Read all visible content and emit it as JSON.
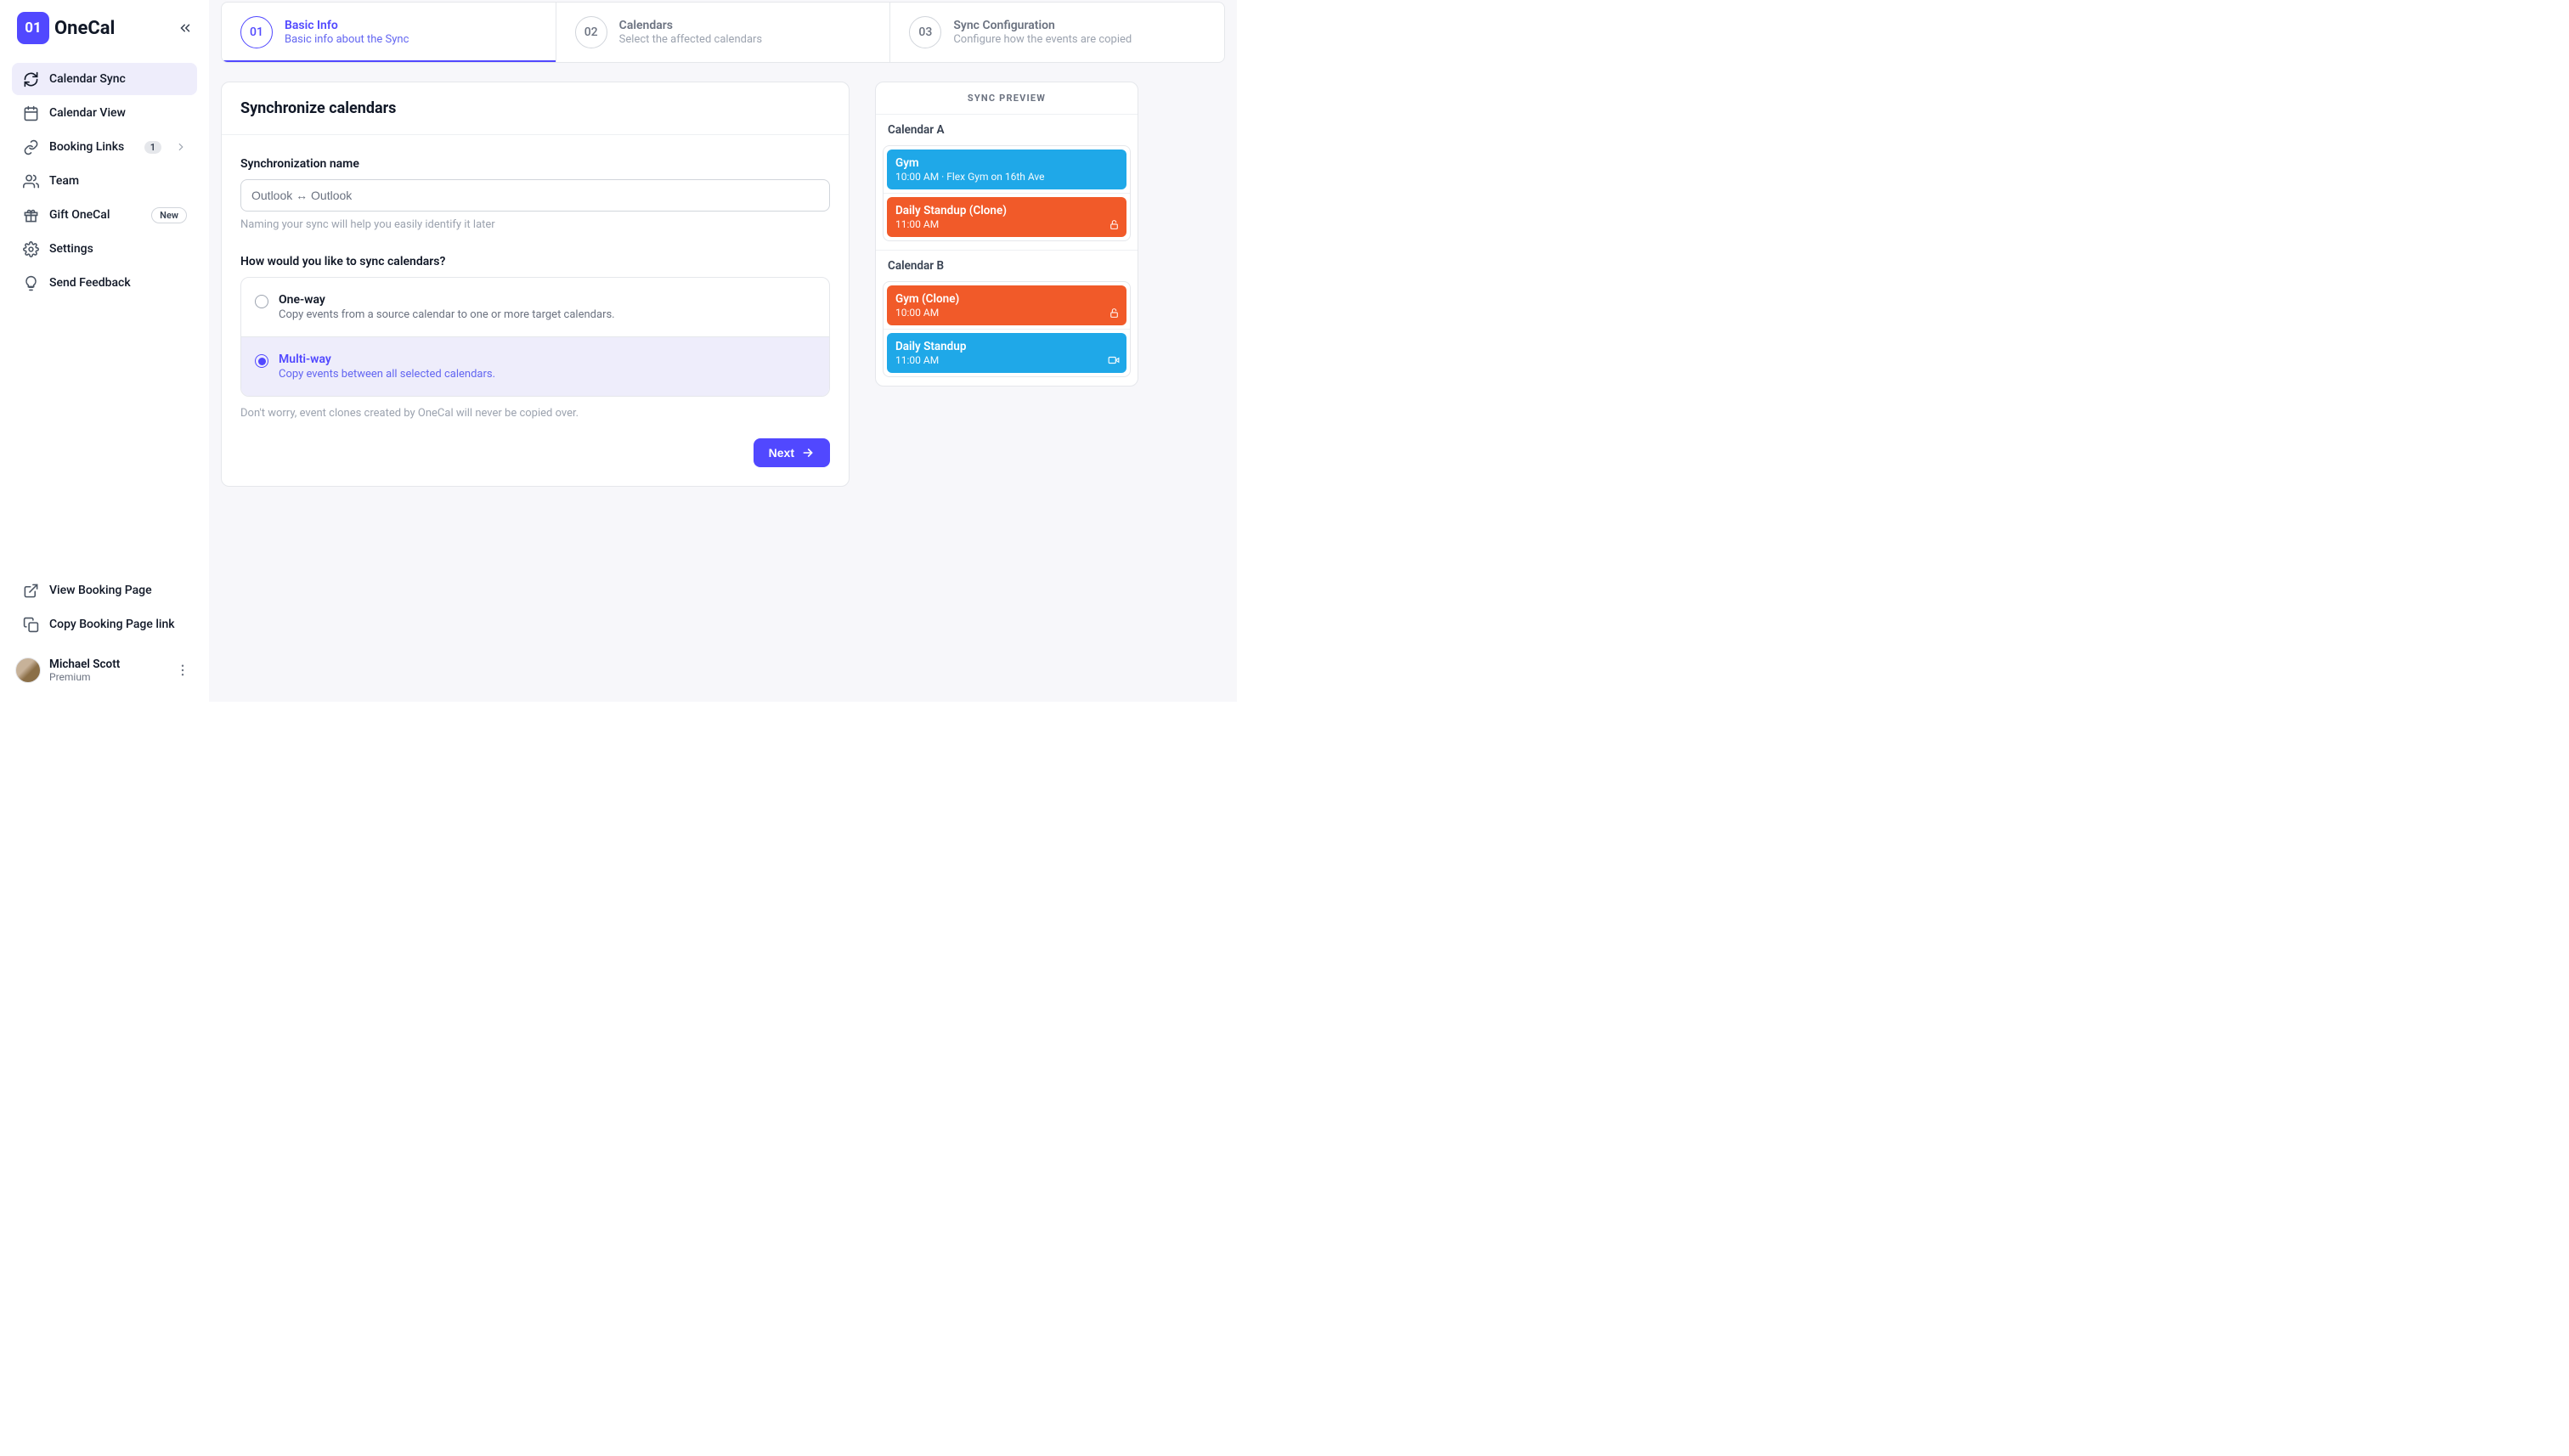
{
  "brand": {
    "badge": "01",
    "name": "OneCal"
  },
  "sidebar": {
    "items": [
      {
        "label": "Calendar Sync"
      },
      {
        "label": "Calendar View"
      },
      {
        "label": "Booking Links",
        "count": "1"
      },
      {
        "label": "Team"
      },
      {
        "label": "Gift OneCal",
        "badge": "New"
      },
      {
        "label": "Settings"
      },
      {
        "label": "Send Feedback"
      }
    ],
    "bottom": [
      {
        "label": "View Booking Page"
      },
      {
        "label": "Copy Booking Page link"
      }
    ]
  },
  "user": {
    "name": "Michael Scott",
    "plan": "Premium"
  },
  "stepper": [
    {
      "num": "01",
      "title": "Basic Info",
      "desc": "Basic info about the Sync"
    },
    {
      "num": "02",
      "title": "Calendars",
      "desc": "Select the affected calendars"
    },
    {
      "num": "03",
      "title": "Sync Configuration",
      "desc": "Configure how the events are copied"
    }
  ],
  "card": {
    "title": "Synchronize calendars",
    "name_label": "Synchronization name",
    "name_value": "Outlook ↔ Outlook",
    "name_helper": "Naming your sync will help you easily identify it later",
    "how_label": "How would you like to sync calendars?",
    "options": [
      {
        "title": "One-way",
        "desc": "Copy events from a source calendar to one or more target calendars."
      },
      {
        "title": "Multi-way",
        "desc": "Copy events between all selected calendars."
      }
    ],
    "options_helper": "Don't worry, event clones created by OneCal will never be copied over.",
    "next": "Next"
  },
  "preview": {
    "title": "SYNC PREVIEW",
    "calendars": [
      {
        "name": "Calendar A",
        "events": [
          {
            "title": "Gym",
            "sub": "10:00 AM · Flex Gym on 16th Ave",
            "color": "blue"
          },
          {
            "title": "Daily Standup (Clone)",
            "sub": "11:00 AM",
            "color": "orange",
            "icon": "lock"
          }
        ]
      },
      {
        "name": "Calendar B",
        "events": [
          {
            "title": "Gym (Clone)",
            "sub": "10:00 AM",
            "color": "orange",
            "icon": "lock"
          },
          {
            "title": "Daily Standup",
            "sub": "11:00 AM",
            "color": "blue",
            "icon": "video"
          }
        ]
      }
    ]
  }
}
